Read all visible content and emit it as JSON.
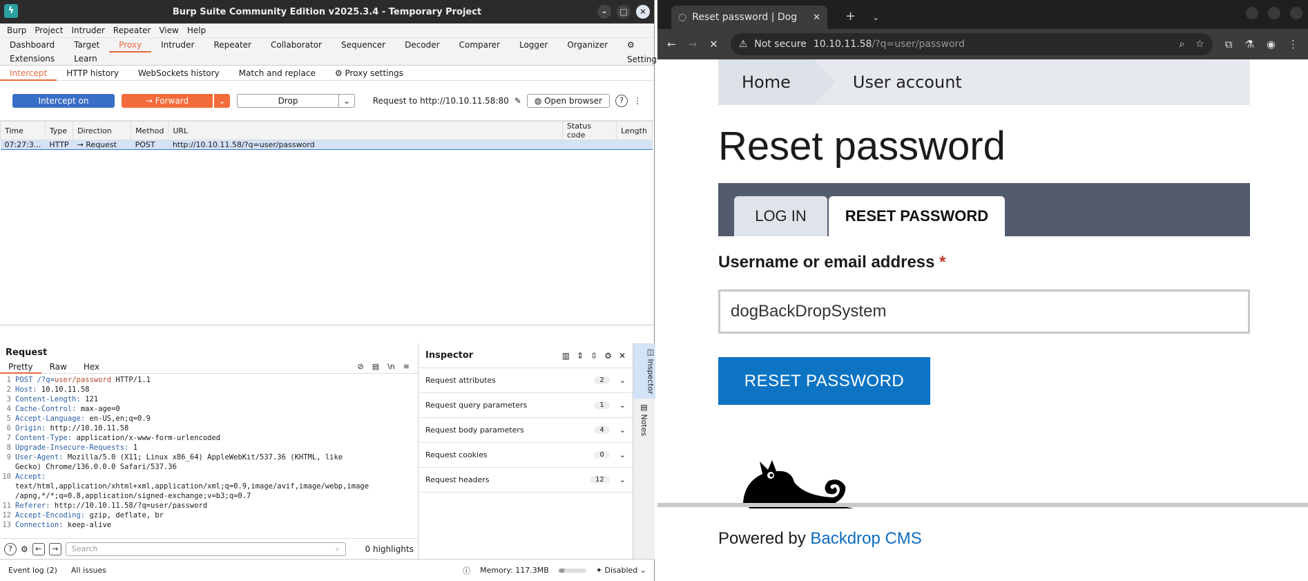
{
  "burp": {
    "title": "Burp Suite Community Edition v2025.3.4 - Temporary Project",
    "menu": [
      "Burp",
      "Project",
      "Intruder",
      "Repeater",
      "View",
      "Help"
    ],
    "tabs_row1": [
      "Dashboard",
      "Target",
      "Proxy",
      "Intruder",
      "Repeater",
      "Collaborator",
      "Sequencer",
      "Decoder",
      "Comparer",
      "Logger",
      "Organizer"
    ],
    "settings_label": "Settings",
    "tabs_row2": [
      "Extensions",
      "Learn"
    ],
    "proxy_tabs": [
      "Intercept",
      "HTTP history",
      "WebSockets history",
      "Match and replace"
    ],
    "proxy_settings": "Proxy settings",
    "intercept_on": "Intercept on",
    "forward": "Forward",
    "drop": "Drop",
    "request_to": "Request to http://10.10.11.58:80",
    "open_browser": "Open browser",
    "columns": [
      "Time",
      "Type",
      "Direction",
      "Method",
      "URL",
      "Status code",
      "Length"
    ],
    "row": {
      "time": "07:27:3...",
      "type": "HTTP",
      "direction": "Request",
      "method": "POST",
      "url": "http://10.10.11.58/?q=user/password",
      "status": "",
      "length": ""
    },
    "request_title": "Request",
    "request_tabs": [
      "Pretty",
      "Raw",
      "Hex"
    ],
    "request_lines": [
      {
        "n": "1",
        "k": "POST /?q=",
        "m": "user/password",
        "v": " HTTP/1.1"
      },
      {
        "n": "2",
        "k": "Host:",
        "v": " 10.10.11.58"
      },
      {
        "n": "3",
        "k": "Content-Length:",
        "v": " 121"
      },
      {
        "n": "4",
        "k": "Cache-Control:",
        "v": " max-age=0"
      },
      {
        "n": "5",
        "k": "Accept-Language:",
        "v": " en-US,en;q=0.9"
      },
      {
        "n": "6",
        "k": "Origin:",
        "v": " http://10.10.11.58"
      },
      {
        "n": "7",
        "k": "Content-Type:",
        "v": " application/x-www-form-urlencoded"
      },
      {
        "n": "8",
        "k": "Upgrade-Insecure-Requests:",
        "v": " 1"
      },
      {
        "n": "9",
        "k": "User-Agent:",
        "v": " Mozilla/5.0 (X11; Linux x86_64) AppleWebKit/537.36 (KHTML, like\nGecko) Chrome/136.0.0.0 Safari/537.36"
      },
      {
        "n": "10",
        "k": "Accept:",
        "v": "\ntext/html,application/xhtml+xml,application/xml;q=0.9,image/avif,image/webp,image\n/apng,*/*;q=0.8,application/signed-exchange;v=b3;q=0.7"
      },
      {
        "n": "11",
        "k": "Referer:",
        "v": " http://10.10.11.58/?q=user/password"
      },
      {
        "n": "12",
        "k": "Accept-Encoding:",
        "v": " gzip, deflate, br"
      },
      {
        "n": "13",
        "k": "Connection:",
        "v": " keep-alive"
      }
    ],
    "search_placeholder": "Search",
    "highlights": "0 highlights",
    "inspector_title": "Inspector",
    "inspector_rows": [
      {
        "label": "Request attributes",
        "count": "2"
      },
      {
        "label": "Request query parameters",
        "count": "1"
      },
      {
        "label": "Request body parameters",
        "count": "4"
      },
      {
        "label": "Request cookies",
        "count": "0"
      },
      {
        "label": "Request headers",
        "count": "12"
      }
    ],
    "side_inspector": "Inspector",
    "side_notes": "Notes",
    "event_log": "Event log (2)",
    "all_issues": "All issues",
    "memory": "Memory: 117.3MB",
    "memory_fraction": 0.2,
    "disabled": "Disabled"
  },
  "browser": {
    "tab_title": "Reset password | Dog",
    "not_secure": "Not secure",
    "url_host": "10.10.11.58",
    "url_path": "/?q=user/password",
    "breadcrumb_home": "Home",
    "breadcrumb_account": "User account",
    "heading": "Reset password",
    "tab_login": "LOG IN",
    "tab_reset": "RESET PASSWORD",
    "field_label": "Username or email address",
    "required_mark": "*",
    "field_value": "dogBackDropSystem",
    "submit": "RESET PASSWORD",
    "powered_by": "Powered by ",
    "powered_link": "Backdrop CMS"
  }
}
